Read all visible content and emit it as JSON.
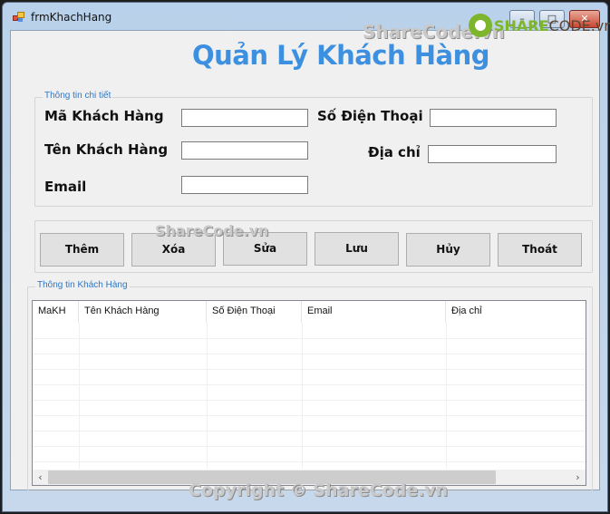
{
  "window": {
    "title": "frmKhachHang",
    "controls": {
      "minimize": "–",
      "maximize": "□",
      "close": "✕"
    }
  },
  "heading": "Quản Lý Khách Hàng",
  "detail_group": {
    "legend": "Thông tin chi tiết",
    "fields": {
      "ma_kh": {
        "label": "Mã Khách Hàng",
        "value": ""
      },
      "ten_kh": {
        "label": "Tên Khách Hàng",
        "value": ""
      },
      "email": {
        "label": "Email",
        "value": ""
      },
      "so_dien_thoai": {
        "label": "Số Điện Thoại",
        "value": ""
      },
      "dia_chi": {
        "label": "Địa chỉ",
        "value": ""
      }
    }
  },
  "buttons": {
    "them": "Thêm",
    "xoa": "Xóa",
    "sua": "Sửa",
    "luu": "Lưu",
    "huy": "Hủy",
    "thoat": "Thoát"
  },
  "list_group": {
    "legend": "Thông tin Khách Hàng",
    "columns": [
      "MaKH",
      "Tên Khách Hàng",
      "Số Điện Thoại",
      "Email",
      "Địa chỉ"
    ],
    "rows": [],
    "scroll": {
      "left": "‹",
      "right": "›"
    }
  },
  "watermarks": {
    "top": "ShareCode.vn",
    "middle": "ShareCode.vn",
    "bottom": "Copyright © ShareCode.vn",
    "logo_a": "SHARE",
    "logo_b": "CODE.vn"
  }
}
